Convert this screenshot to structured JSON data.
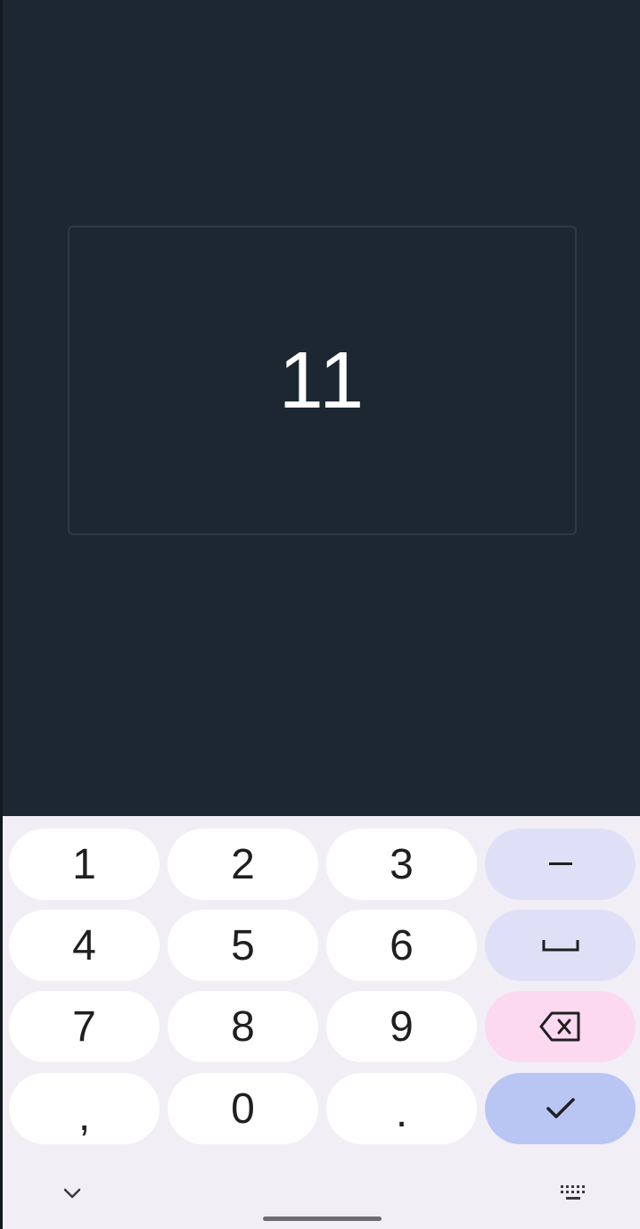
{
  "display": {
    "value": "11"
  },
  "keyboard": {
    "row1": {
      "k1": "1",
      "k2": "2",
      "k3": "3",
      "fn": "minus-icon"
    },
    "row2": {
      "k1": "4",
      "k2": "5",
      "k3": "6",
      "fn": "space-icon"
    },
    "row3": {
      "k1": "7",
      "k2": "8",
      "k3": "9",
      "fn": "backspace-icon"
    },
    "row4": {
      "k1": ",",
      "k2": "0",
      "k3": ".",
      "fn": "checkmark-icon"
    },
    "bottom": {
      "left_icon": "chevron-down-icon",
      "right_icon": "keyboard-icon"
    }
  },
  "colors": {
    "app_background": "#1d2731",
    "keyboard_background": "#f1eef5",
    "key_background": "#ffffff",
    "function_key": "#dfdff8",
    "delete_key": "#fdd8f1",
    "enter_key": "#b9c6f4",
    "display_text": "#ffffff"
  }
}
